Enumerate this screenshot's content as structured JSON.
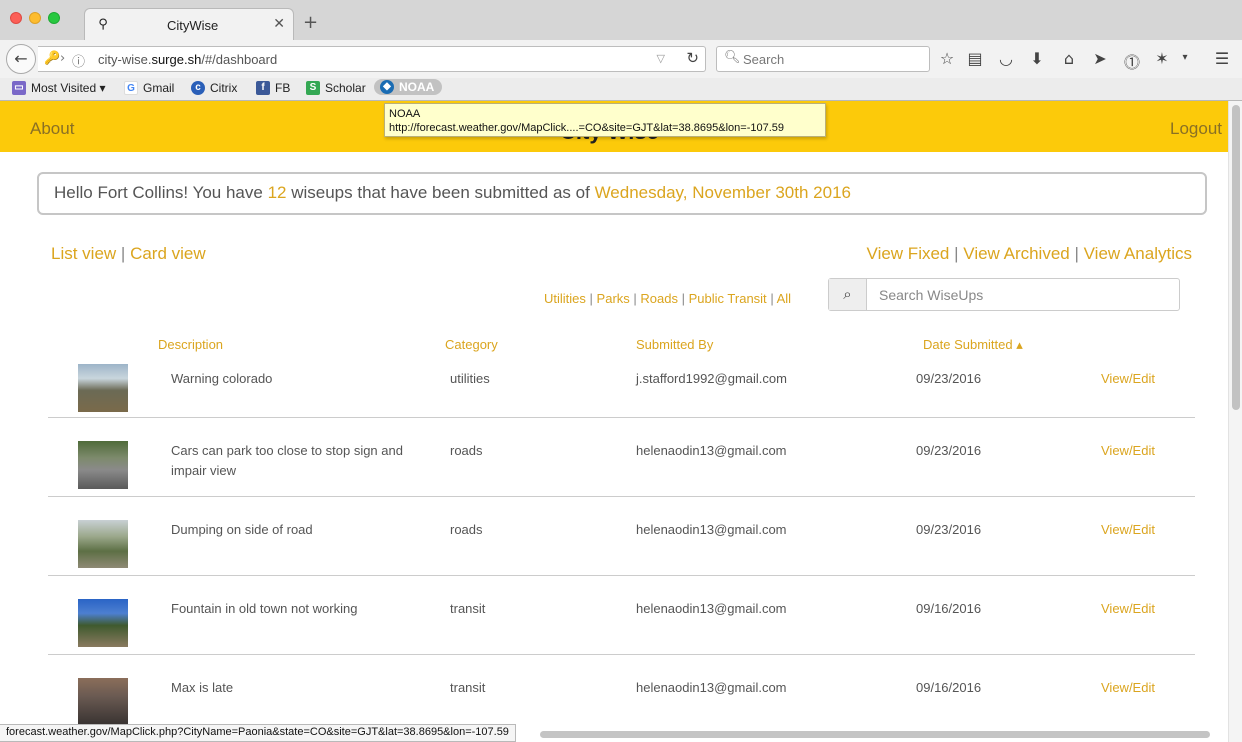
{
  "browser": {
    "tab_title": "CityWise",
    "tab_close": "✕",
    "new_tab": "+",
    "url_host_prefix": "city-wise.",
    "url_host_main": "surge.sh",
    "url_path": "/#/dashboard",
    "search_placeholder": "Search",
    "bookmarks": [
      {
        "label": "Most Visited ▾",
        "icon": "folder-icon",
        "color": "#7a68c8"
      },
      {
        "label": "Gmail",
        "icon": "google-icon",
        "color": "#4285f4"
      },
      {
        "label": "Citrix",
        "icon": "citrix-icon",
        "color": "#2a5fb8"
      },
      {
        "label": "FB",
        "icon": "facebook-icon",
        "color": "#3b5998"
      },
      {
        "label": "Scholar",
        "icon": "scholar-icon",
        "color": "#34a853"
      },
      {
        "label": "NOAA",
        "icon": "noaa-icon",
        "color": "#1a6cb3"
      }
    ],
    "tooltip_title": "NOAA",
    "tooltip_url": "http://forecast.weather.gov/MapClick....=CO&site=GJT&lat=38.8695&lon=-107.59",
    "status_url": "forecast.weather.gov/MapClick.php?CityName=Paonia&state=CO&site=GJT&lat=38.8695&lon=-107.59"
  },
  "header": {
    "about": "About",
    "brand": "City Wise",
    "logout": "Logout",
    "bg_color": "#fcca0a"
  },
  "greeting": {
    "prefix": "Hello Fort Collins! You have ",
    "count": "12",
    "middle": " wiseups that have been submitted as of ",
    "date": "Wednesday, November 30th 2016"
  },
  "views": {
    "list": "List view",
    "card": "Card view",
    "fixed": "View Fixed",
    "archived": "View Archived",
    "analytics": "View Analytics",
    "separator": "|"
  },
  "filters": {
    "utilities": "Utilities",
    "parks": "Parks",
    "roads": "Roads",
    "transit": "Public Transit",
    "all": "All",
    "separator": "|"
  },
  "search": {
    "placeholder": "Search WiseUps"
  },
  "table": {
    "headers": {
      "description": "Description",
      "category": "Category",
      "submitted_by": "Submitted By",
      "date": "Date Submitted ▴"
    },
    "rows": [
      {
        "description": "Warning colorado",
        "category": "utilities",
        "submitted_by": "j.stafford1992@gmail.com",
        "date": "09/23/2016",
        "action": "View/Edit"
      },
      {
        "description": "Cars can park too close to stop sign and impair view",
        "category": "roads",
        "submitted_by": "helenaodin13@gmail.com",
        "date": "09/23/2016",
        "action": "View/Edit"
      },
      {
        "description": "Dumping on side of road",
        "category": "roads",
        "submitted_by": "helenaodin13@gmail.com",
        "date": "09/23/2016",
        "action": "View/Edit"
      },
      {
        "description": "Fountain in old town not working",
        "category": "transit",
        "submitted_by": "helenaodin13@gmail.com",
        "date": "09/16/2016",
        "action": "View/Edit"
      },
      {
        "description": "Max is late",
        "category": "transit",
        "submitted_by": "helenaodin13@gmail.com",
        "date": "09/16/2016",
        "action": "View/Edit"
      }
    ]
  },
  "accent_color": "#dba51f"
}
